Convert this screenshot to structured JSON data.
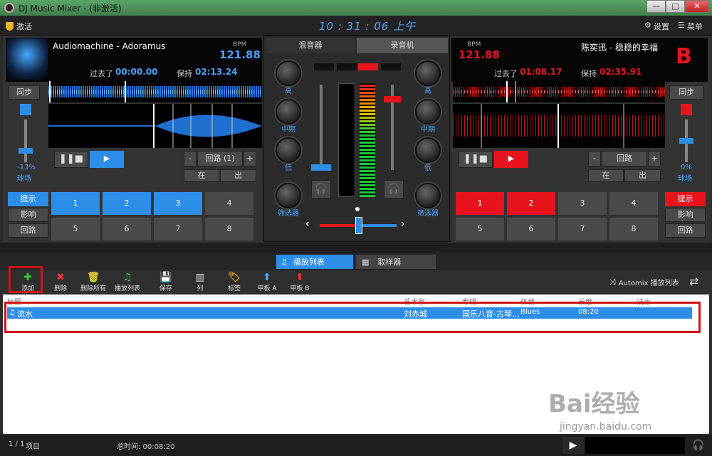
{
  "window": {
    "title": "DJ Music Mixer - (非激活)",
    "min": "—",
    "max": "□",
    "close": "✕"
  },
  "topbar": {
    "activate": "激活",
    "clock": "10 : 31 : 06 上午",
    "settings": "设置",
    "menu": "菜单"
  },
  "deckA": {
    "title": "Audiomachine - Adoramus",
    "bpm_label": "BPM",
    "bpm": "121.88",
    "elapsed_label": "过去了",
    "elapsed": "00:00.00",
    "remain_label": "保持",
    "remain": "02:13.24",
    "sync": "同步",
    "pitch": "-13%",
    "pitch_label": "球场",
    "loop": "回路 (1)",
    "minus": "-",
    "plus": "+",
    "in": "在",
    "out": "出",
    "cue": "提示",
    "effect": "影响",
    "loop_btn": "回路",
    "pads": [
      "1",
      "2",
      "3",
      "4",
      "5",
      "6",
      "7",
      "8"
    ]
  },
  "deckB": {
    "title": "陈奕迅 - 稳稳的幸福",
    "bpm_label": "BPM",
    "bpm": "121.88",
    "elapsed_label": "过去了",
    "elapsed": "01:08.17",
    "remain_label": "保持",
    "remain": "02:35.91",
    "letter": "B",
    "sync": "同步",
    "pitch": "0%",
    "pitch_label": "球场",
    "loop": "回路",
    "minus": "-",
    "plus": "+",
    "in": "在",
    "out": "出",
    "cue": "提示",
    "effect": "影响",
    "loop_btn": "回路",
    "pads": [
      "1",
      "2",
      "3",
      "4",
      "5",
      "6",
      "7",
      "8"
    ]
  },
  "mixer": {
    "tab_mixer": "混音器",
    "tab_recorder": "录音机",
    "high": "高",
    "mid": "中期",
    "low": "低",
    "filter": "筛选器"
  },
  "playlist": {
    "tab_playlist": "播放列表",
    "tab_sampler": "取样器",
    "toolbar": [
      "添加",
      "删除",
      "删除所有",
      "播放列表",
      "保存",
      "列",
      "标签",
      "甲板 A",
      "甲板 B"
    ],
    "automix": "Automix 播放列表",
    "headers": [
      "标题",
      "艺术家",
      "专辑",
      "体裁",
      "长度",
      "法士"
    ],
    "rows": [
      {
        "title": "流水",
        "artist": "刘赤城",
        "album": "国乐八音-古琴...",
        "genre": "Blues",
        "length": "08:20"
      }
    ]
  },
  "status": {
    "count": "1 / 1",
    "items": "项目",
    "total": "总时间: 00:08:20"
  },
  "watermark": {
    "main": "Bai经验",
    "sub": "jingyan.baidu.com"
  }
}
